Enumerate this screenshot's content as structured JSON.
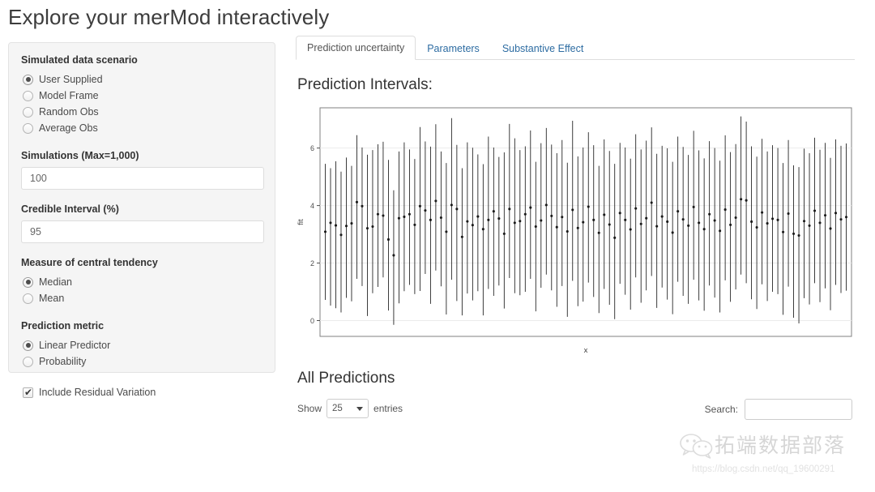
{
  "page": {
    "title": "Explore your merMod interactively"
  },
  "sidebar": {
    "scenario": {
      "label": "Simulated data scenario",
      "options": [
        {
          "label": "User Supplied",
          "selected": true
        },
        {
          "label": "Model Frame",
          "selected": false
        },
        {
          "label": "Random Obs",
          "selected": false
        },
        {
          "label": "Average Obs",
          "selected": false
        }
      ]
    },
    "simulations": {
      "label": "Simulations (Max=1,000)",
      "value": "100",
      "placeholder": ""
    },
    "credible_interval": {
      "label": "Credible Interval (%)",
      "value": "95",
      "placeholder": ""
    },
    "central_tendency": {
      "label": "Measure of central tendency",
      "options": [
        {
          "label": "Median",
          "selected": true
        },
        {
          "label": "Mean",
          "selected": false
        }
      ]
    },
    "prediction_metric": {
      "label": "Prediction metric",
      "options": [
        {
          "label": "Linear Predictor",
          "selected": true
        },
        {
          "label": "Probability",
          "selected": false
        }
      ]
    },
    "residual_variation": {
      "label": "Include Residual Variation",
      "checked": true,
      "check_glyph": "✔"
    }
  },
  "main": {
    "tabs": [
      {
        "label": "Prediction uncertainty",
        "active": true
      },
      {
        "label": "Parameters",
        "active": false
      },
      {
        "label": "Substantive Effect",
        "active": false
      }
    ],
    "plot_title": "Prediction Intervals:",
    "table_title": "All Predictions",
    "controls": {
      "show_label": "Show",
      "entries_label": "entries",
      "page_length": "25",
      "search_label": "Search:",
      "search_value": "",
      "search_placeholder": ""
    }
  },
  "watermark": {
    "brand": "拓端数据部落",
    "url": "https://blog.csdn.net/qq_19600291"
  },
  "colors": {
    "link": "#2d6ca2",
    "panel_bg": "#f5f5f5",
    "panel_border": "#e3e3e3",
    "text": "#333333",
    "plot_line": "#1a1a1a",
    "plot_border": "#808080",
    "grid": "#ebebeb"
  },
  "chart_data": {
    "type": "scatter",
    "title": "Prediction Intervals:",
    "xlabel": "x",
    "ylabel": "fit",
    "ylim": [
      -0.55,
      7.4
    ],
    "yticks": [
      0,
      2,
      4,
      6
    ],
    "xticks": [],
    "grid": true,
    "legend": null,
    "series_note": "Point estimate (median fit) with 95% credible interval bars, one per observation",
    "points": [
      {
        "x": 1,
        "fit": 3.09,
        "lo": 0.72,
        "hi": 5.45
      },
      {
        "x": 2,
        "fit": 3.4,
        "lo": 0.52,
        "hi": 5.3
      },
      {
        "x": 3,
        "fit": 3.31,
        "lo": 0.43,
        "hi": 5.54
      },
      {
        "x": 4,
        "fit": 2.98,
        "lo": 0.28,
        "hi": 5.18
      },
      {
        "x": 5,
        "fit": 3.29,
        "lo": 0.79,
        "hi": 5.67
      },
      {
        "x": 6,
        "fit": 3.38,
        "lo": 0.67,
        "hi": 5.38
      },
      {
        "x": 7,
        "fit": 4.12,
        "lo": 1.45,
        "hi": 6.45
      },
      {
        "x": 8,
        "fit": 3.98,
        "lo": 1.2,
        "hi": 6.02
      },
      {
        "x": 9,
        "fit": 3.21,
        "lo": 0.16,
        "hi": 5.77
      },
      {
        "x": 10,
        "fit": 3.27,
        "lo": 0.95,
        "hi": 5.93
      },
      {
        "x": 11,
        "fit": 3.7,
        "lo": 1.17,
        "hi": 6.13
      },
      {
        "x": 12,
        "fit": 3.65,
        "lo": 1.5,
        "hi": 6.22
      },
      {
        "x": 13,
        "fit": 2.82,
        "lo": 0.35,
        "hi": 5.59
      },
      {
        "x": 14,
        "fit": 2.27,
        "lo": -0.15,
        "hi": 4.53
      },
      {
        "x": 15,
        "fit": 3.56,
        "lo": 0.6,
        "hi": 5.88
      },
      {
        "x": 16,
        "fit": 3.61,
        "lo": 1.02,
        "hi": 6.2
      },
      {
        "x": 17,
        "fit": 3.7,
        "lo": 1.24,
        "hi": 5.95
      },
      {
        "x": 18,
        "fit": 3.33,
        "lo": 0.92,
        "hi": 5.62
      },
      {
        "x": 19,
        "fit": 3.98,
        "lo": 1.03,
        "hi": 6.73
      },
      {
        "x": 20,
        "fit": 3.83,
        "lo": 1.62,
        "hi": 6.23
      },
      {
        "x": 21,
        "fit": 3.5,
        "lo": 0.58,
        "hi": 6.05
      },
      {
        "x": 22,
        "fit": 4.16,
        "lo": 1.74,
        "hi": 6.83
      },
      {
        "x": 23,
        "fit": 3.58,
        "lo": 1.19,
        "hi": 5.88
      },
      {
        "x": 24,
        "fit": 3.09,
        "lo": 0.21,
        "hi": 5.48
      },
      {
        "x": 25,
        "fit": 4.02,
        "lo": 1.42,
        "hi": 7.04
      },
      {
        "x": 26,
        "fit": 3.88,
        "lo": 0.68,
        "hi": 6.11
      },
      {
        "x": 27,
        "fit": 2.91,
        "lo": 0.18,
        "hi": 5.3
      },
      {
        "x": 28,
        "fit": 3.45,
        "lo": 0.94,
        "hi": 6.2
      },
      {
        "x": 29,
        "fit": 3.32,
        "lo": 0.7,
        "hi": 6.01
      },
      {
        "x": 30,
        "fit": 3.62,
        "lo": 1.02,
        "hi": 5.78
      },
      {
        "x": 31,
        "fit": 3.18,
        "lo": 0.18,
        "hi": 5.44
      },
      {
        "x": 32,
        "fit": 3.5,
        "lo": 1.1,
        "hi": 6.4
      },
      {
        "x": 33,
        "fit": 3.8,
        "lo": 0.86,
        "hi": 6.02
      },
      {
        "x": 34,
        "fit": 3.55,
        "lo": 1.22,
        "hi": 5.69
      },
      {
        "x": 35,
        "fit": 3.02,
        "lo": 0.42,
        "hi": 5.85
      },
      {
        "x": 36,
        "fit": 3.88,
        "lo": 1.48,
        "hi": 6.84
      },
      {
        "x": 37,
        "fit": 3.4,
        "lo": 0.95,
        "hi": 6.34
      },
      {
        "x": 38,
        "fit": 3.46,
        "lo": 0.88,
        "hi": 5.93
      },
      {
        "x": 39,
        "fit": 3.7,
        "lo": 1.0,
        "hi": 6.06
      },
      {
        "x": 40,
        "fit": 3.93,
        "lo": 1.45,
        "hi": 6.61
      },
      {
        "x": 41,
        "fit": 3.27,
        "lo": 0.32,
        "hi": 5.52
      },
      {
        "x": 42,
        "fit": 3.48,
        "lo": 1.14,
        "hi": 6.17
      },
      {
        "x": 43,
        "fit": 4.02,
        "lo": 1.6,
        "hi": 6.7
      },
      {
        "x": 44,
        "fit": 3.64,
        "lo": 1.05,
        "hi": 6.12
      },
      {
        "x": 45,
        "fit": 3.25,
        "lo": 0.48,
        "hi": 5.82
      },
      {
        "x": 46,
        "fit": 3.6,
        "lo": 1.2,
        "hi": 6.28
      },
      {
        "x": 47,
        "fit": 3.1,
        "lo": 0.13,
        "hi": 5.49
      },
      {
        "x": 48,
        "fit": 3.85,
        "lo": 1.38,
        "hi": 6.95
      },
      {
        "x": 49,
        "fit": 3.22,
        "lo": 0.5,
        "hi": 5.71
      },
      {
        "x": 50,
        "fit": 3.42,
        "lo": 0.66,
        "hi": 6.02
      },
      {
        "x": 51,
        "fit": 3.96,
        "lo": 1.32,
        "hi": 6.55
      },
      {
        "x": 52,
        "fit": 3.5,
        "lo": 0.82,
        "hi": 6.1
      },
      {
        "x": 53,
        "fit": 3.05,
        "lo": 0.26,
        "hi": 5.38
      },
      {
        "x": 54,
        "fit": 3.68,
        "lo": 1.1,
        "hi": 6.3
      },
      {
        "x": 55,
        "fit": 3.34,
        "lo": 0.55,
        "hi": 5.9
      },
      {
        "x": 56,
        "fit": 2.88,
        "lo": 0.05,
        "hi": 5.45
      },
      {
        "x": 57,
        "fit": 3.74,
        "lo": 1.28,
        "hi": 6.18
      },
      {
        "x": 58,
        "fit": 3.5,
        "lo": 0.9,
        "hi": 6.02
      },
      {
        "x": 59,
        "fit": 3.17,
        "lo": 0.38,
        "hi": 5.63
      },
      {
        "x": 60,
        "fit": 3.9,
        "lo": 1.5,
        "hi": 6.48
      },
      {
        "x": 61,
        "fit": 3.36,
        "lo": 0.62,
        "hi": 5.95
      },
      {
        "x": 62,
        "fit": 3.56,
        "lo": 1.05,
        "hi": 6.26
      },
      {
        "x": 63,
        "fit": 4.1,
        "lo": 1.55,
        "hi": 6.72
      },
      {
        "x": 64,
        "fit": 3.28,
        "lo": 0.44,
        "hi": 5.8
      },
      {
        "x": 65,
        "fit": 3.62,
        "lo": 1.15,
        "hi": 6.08
      },
      {
        "x": 66,
        "fit": 3.44,
        "lo": 0.73,
        "hi": 5.99
      },
      {
        "x": 67,
        "fit": 3.06,
        "lo": 0.22,
        "hi": 5.52
      },
      {
        "x": 68,
        "fit": 3.8,
        "lo": 1.35,
        "hi": 6.4
      },
      {
        "x": 69,
        "fit": 3.52,
        "lo": 0.86,
        "hi": 6.04
      },
      {
        "x": 70,
        "fit": 3.3,
        "lo": 0.58,
        "hi": 5.76
      },
      {
        "x": 71,
        "fit": 3.95,
        "lo": 1.42,
        "hi": 6.6
      },
      {
        "x": 72,
        "fit": 3.4,
        "lo": 0.7,
        "hi": 5.92
      },
      {
        "x": 73,
        "fit": 3.18,
        "lo": 0.34,
        "hi": 5.64
      },
      {
        "x": 74,
        "fit": 3.7,
        "lo": 1.22,
        "hi": 6.24
      },
      {
        "x": 75,
        "fit": 3.48,
        "lo": 0.8,
        "hi": 6.0
      },
      {
        "x": 76,
        "fit": 3.12,
        "lo": 0.28,
        "hi": 5.56
      },
      {
        "x": 77,
        "fit": 3.86,
        "lo": 1.4,
        "hi": 6.44
      },
      {
        "x": 78,
        "fit": 3.33,
        "lo": 0.65,
        "hi": 5.86
      },
      {
        "x": 79,
        "fit": 3.58,
        "lo": 1.08,
        "hi": 6.14
      },
      {
        "x": 80,
        "fit": 4.22,
        "lo": 1.6,
        "hi": 7.1
      },
      {
        "x": 81,
        "fit": 4.18,
        "lo": 1.3,
        "hi": 6.92
      },
      {
        "x": 82,
        "fit": 3.44,
        "lo": 0.74,
        "hi": 6.06
      },
      {
        "x": 83,
        "fit": 3.24,
        "lo": 0.4,
        "hi": 5.7
      },
      {
        "x": 84,
        "fit": 3.76,
        "lo": 1.26,
        "hi": 6.32
      },
      {
        "x": 85,
        "fit": 3.38,
        "lo": 0.68,
        "hi": 5.88
      },
      {
        "x": 86,
        "fit": 3.54,
        "lo": 1.0,
        "hi": 6.1
      },
      {
        "x": 87,
        "fit": 3.5,
        "lo": 0.92,
        "hi": 6.0
      },
      {
        "x": 88,
        "fit": 3.08,
        "lo": 0.2,
        "hi": 5.48
      },
      {
        "x": 89,
        "fit": 3.72,
        "lo": 1.18,
        "hi": 6.28
      },
      {
        "x": 90,
        "fit": 3.02,
        "lo": 0.1,
        "hi": 5.4
      },
      {
        "x": 91,
        "fit": 2.96,
        "lo": -0.1,
        "hi": 5.34
      },
      {
        "x": 92,
        "fit": 3.46,
        "lo": 0.78,
        "hi": 5.98
      },
      {
        "x": 93,
        "fit": 3.3,
        "lo": 0.56,
        "hi": 5.82
      },
      {
        "x": 94,
        "fit": 3.82,
        "lo": 1.3,
        "hi": 6.36
      },
      {
        "x": 95,
        "fit": 3.4,
        "lo": 0.64,
        "hi": 5.94
      },
      {
        "x": 96,
        "fit": 3.66,
        "lo": 1.12,
        "hi": 6.18
      },
      {
        "x": 97,
        "fit": 3.2,
        "lo": 0.36,
        "hi": 5.66
      },
      {
        "x": 98,
        "fit": 3.74,
        "lo": 1.24,
        "hi": 6.3
      },
      {
        "x": 99,
        "fit": 3.52,
        "lo": 0.96,
        "hi": 6.08
      },
      {
        "x": 100,
        "fit": 3.6,
        "lo": 1.04,
        "hi": 6.16
      }
    ]
  }
}
